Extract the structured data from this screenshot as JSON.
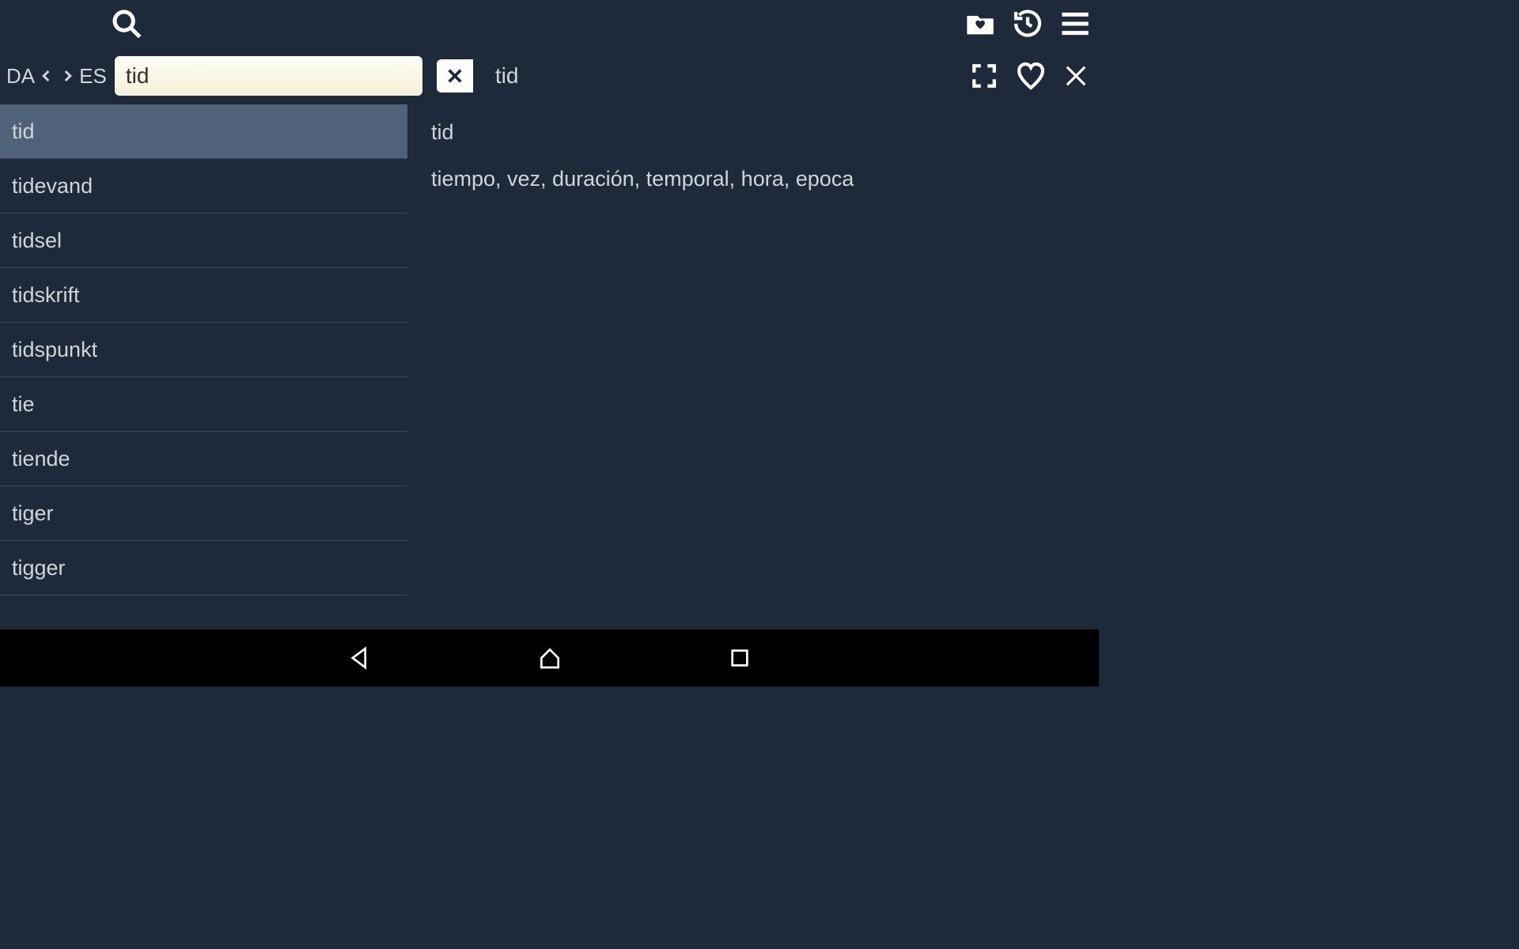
{
  "lang": {
    "from": "DA",
    "to": "ES"
  },
  "search": {
    "value": "tid",
    "placeholder": ""
  },
  "header_word": "tid",
  "list": {
    "items": [
      {
        "label": "tid",
        "selected": true
      },
      {
        "label": "tidevand",
        "selected": false
      },
      {
        "label": "tidsel",
        "selected": false
      },
      {
        "label": "tidskrift",
        "selected": false
      },
      {
        "label": "tidspunkt",
        "selected": false
      },
      {
        "label": "tie",
        "selected": false
      },
      {
        "label": "tiende",
        "selected": false
      },
      {
        "label": "tiger",
        "selected": false
      },
      {
        "label": "tigger",
        "selected": false
      }
    ]
  },
  "detail": {
    "word": "tid",
    "translations": "tiempo, vez, duración, temporal, hora, epoca"
  }
}
